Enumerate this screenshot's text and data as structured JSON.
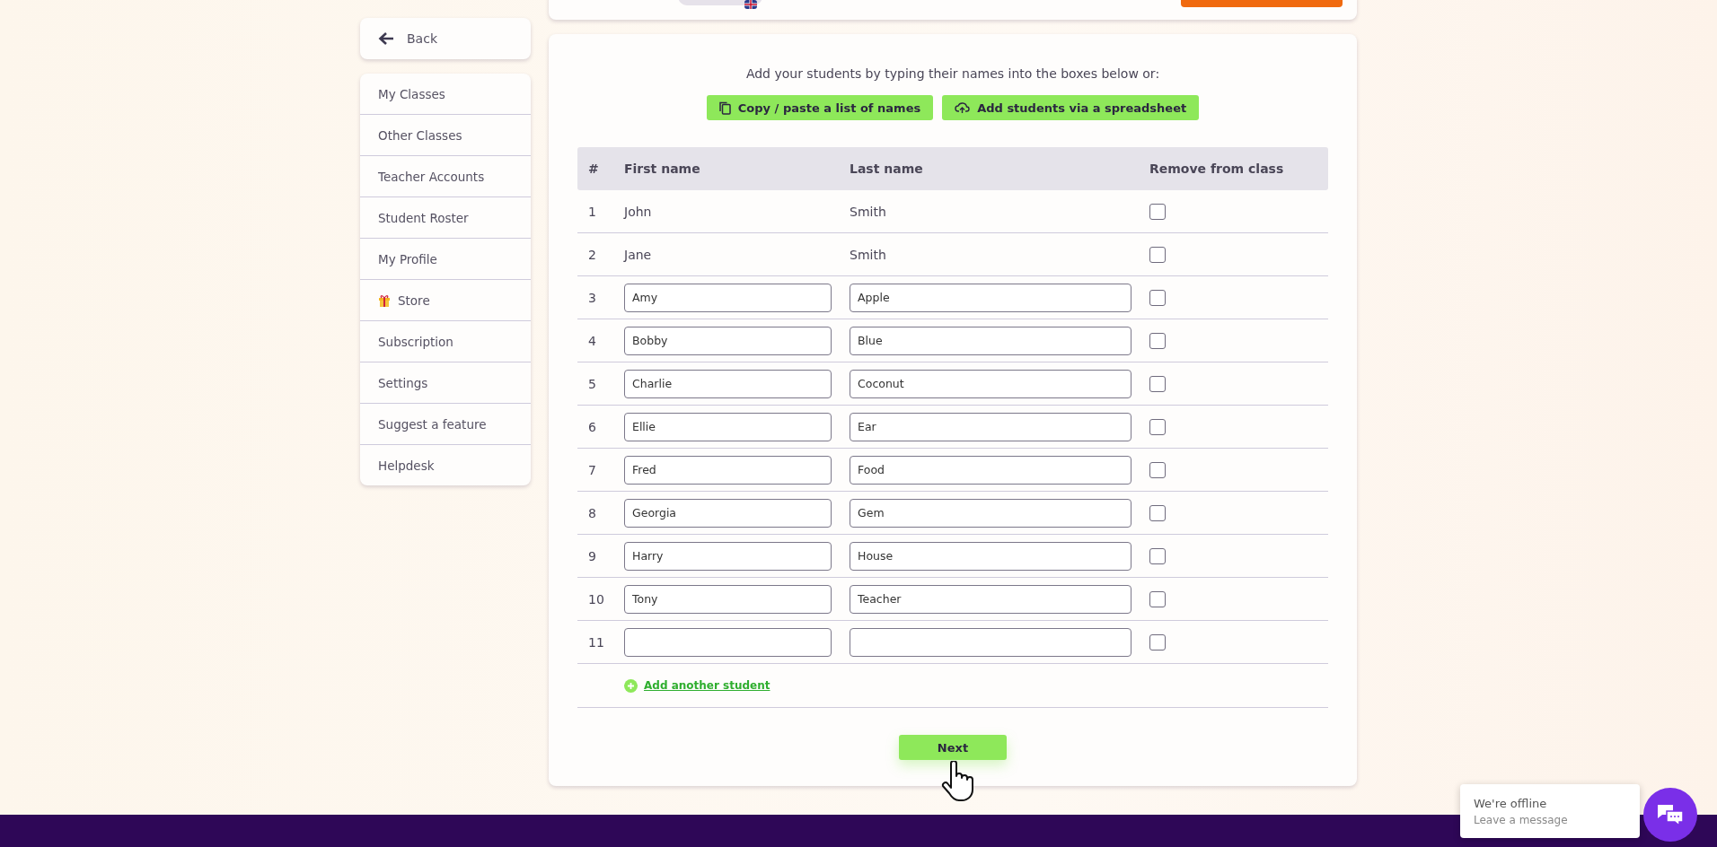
{
  "sidebar": {
    "back": "Back",
    "items": [
      {
        "label": "My Classes",
        "kind": "plain"
      },
      {
        "label": "Other Classes",
        "kind": "plain"
      },
      {
        "label": "Teacher Accounts",
        "kind": "plain"
      },
      {
        "label": "Student Roster",
        "kind": "plain"
      },
      {
        "label": "My Profile",
        "kind": "plain"
      },
      {
        "label": "Store",
        "kind": "gift"
      },
      {
        "label": "Subscription",
        "kind": "plain"
      },
      {
        "label": "Settings",
        "kind": "plain"
      },
      {
        "label": "Suggest a feature",
        "kind": "plain"
      },
      {
        "label": "Helpdesk",
        "kind": "plain"
      }
    ]
  },
  "main": {
    "intro": "Add your students by typing their names into the boxes below or:",
    "actions": [
      {
        "label": "Copy / paste a list of names",
        "kind": "copy"
      },
      {
        "label": "Add students via a spreadsheet",
        "kind": "upload"
      }
    ],
    "table": {
      "columns": [
        "#",
        "First name",
        "Last name",
        "Remove from class"
      ],
      "rows": [
        {
          "number": "1",
          "kind": "text",
          "first": "John",
          "last": "Smith",
          "checked": false
        },
        {
          "number": "2",
          "kind": "text",
          "first": "Jane",
          "last": "Smith",
          "checked": false
        },
        {
          "number": "3",
          "kind": "input",
          "first": "Amy",
          "last": "Apple",
          "checked": false
        },
        {
          "number": "4",
          "kind": "input",
          "first": "Bobby",
          "last": "Blue",
          "checked": false
        },
        {
          "number": "5",
          "kind": "input",
          "first": "Charlie",
          "last": "Coconut",
          "checked": false
        },
        {
          "number": "6",
          "kind": "input",
          "first": "Ellie",
          "last": "Ear",
          "checked": false
        },
        {
          "number": "7",
          "kind": "input",
          "first": "Fred",
          "last": "Food",
          "checked": false
        },
        {
          "number": "8",
          "kind": "input",
          "first": "Georgia",
          "last": "Gem",
          "checked": false
        },
        {
          "number": "9",
          "kind": "input",
          "first": "Harry",
          "last": "House",
          "checked": false
        },
        {
          "number": "10",
          "kind": "input",
          "first": "Tony",
          "last": "Teacher",
          "checked": false
        },
        {
          "number": "11",
          "kind": "input",
          "first": "",
          "last": "",
          "checked": false
        }
      ]
    },
    "add_link": "Add another student",
    "next": "Next"
  },
  "chat": {
    "status": "We're offline",
    "prompt": "Leave a message"
  }
}
